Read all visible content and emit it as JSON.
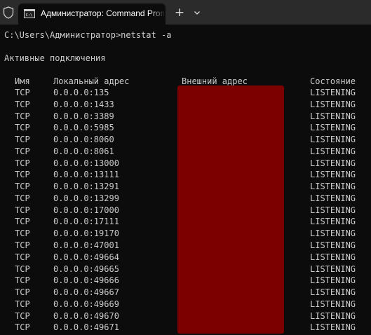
{
  "titlebar": {
    "tab_title": "Администратор: Command Prompt",
    "new_tab_icon": "plus-icon",
    "dropdown_icon": "chevron-down-icon",
    "shield_icon": "shield-icon"
  },
  "console": {
    "command_line": "C:\\Users\\Администратор>netstat -a",
    "section_title": "Активные подключения",
    "headers": {
      "proto": "Имя",
      "local": "Локальный адрес",
      "foreign": "Внешний адрес",
      "state": "Состояние"
    },
    "rows": [
      {
        "proto": "TCP",
        "local": "0.0.0.0:135",
        "state": "LISTENING"
      },
      {
        "proto": "TCP",
        "local": "0.0.0.0:1433",
        "state": "LISTENING"
      },
      {
        "proto": "TCP",
        "local": "0.0.0.0:3389",
        "state": "LISTENING"
      },
      {
        "proto": "TCP",
        "local": "0.0.0.0:5985",
        "state": "LISTENING"
      },
      {
        "proto": "TCP",
        "local": "0.0.0.0:8060",
        "state": "LISTENING"
      },
      {
        "proto": "TCP",
        "local": "0.0.0.0:8061",
        "state": "LISTENING"
      },
      {
        "proto": "TCP",
        "local": "0.0.0.0:13000",
        "state": "LISTENING"
      },
      {
        "proto": "TCP",
        "local": "0.0.0.0:13111",
        "state": "LISTENING"
      },
      {
        "proto": "TCP",
        "local": "0.0.0.0:13291",
        "state": "LISTENING"
      },
      {
        "proto": "TCP",
        "local": "0.0.0.0:13299",
        "state": "LISTENING"
      },
      {
        "proto": "TCP",
        "local": "0.0.0.0:17000",
        "state": "LISTENING"
      },
      {
        "proto": "TCP",
        "local": "0.0.0.0:17111",
        "state": "LISTENING"
      },
      {
        "proto": "TCP",
        "local": "0.0.0.0:19170",
        "state": "LISTENING"
      },
      {
        "proto": "TCP",
        "local": "0.0.0.0:47001",
        "state": "LISTENING"
      },
      {
        "proto": "TCP",
        "local": "0.0.0.0:49664",
        "state": "LISTENING"
      },
      {
        "proto": "TCP",
        "local": "0.0.0.0:49665",
        "state": "LISTENING"
      },
      {
        "proto": "TCP",
        "local": "0.0.0.0:49666",
        "state": "LISTENING"
      },
      {
        "proto": "TCP",
        "local": "0.0.0.0:49667",
        "state": "LISTENING"
      },
      {
        "proto": "TCP",
        "local": "0.0.0.0:49669",
        "state": "LISTENING"
      },
      {
        "proto": "TCP",
        "local": "0.0.0.0:49670",
        "state": "LISTENING"
      },
      {
        "proto": "TCP",
        "local": "0.0.0.0:49671",
        "state": "LISTENING"
      }
    ]
  },
  "colors": {
    "background": "#0c0c0c",
    "titlebar": "#2b2b2b",
    "text": "#cccccc",
    "redaction": "#7c0000"
  }
}
